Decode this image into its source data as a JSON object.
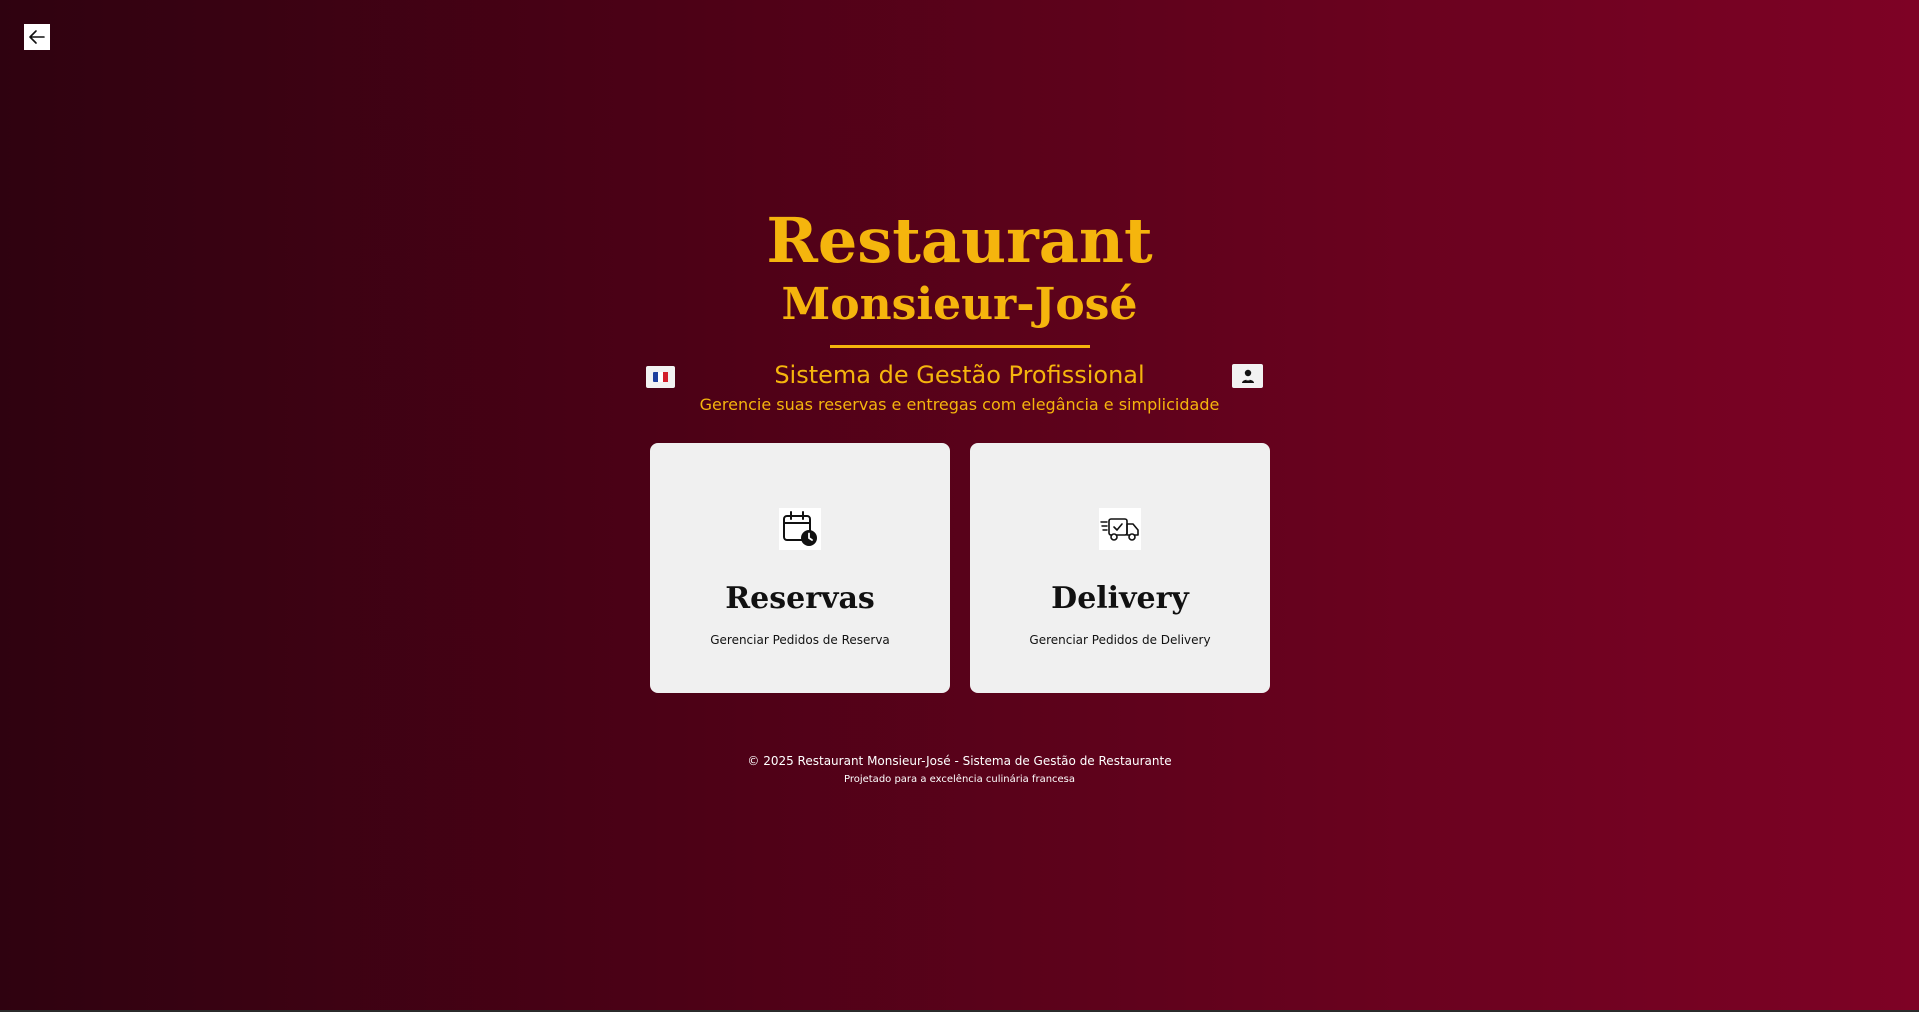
{
  "header": {
    "title_line1": "Restaurant",
    "title_line2": "Monsieur-José",
    "subtitle": "Sistema de Gestão Profissional",
    "tagline": "Gerencie suas reservas e entregas com elegância e simplicidade"
  },
  "colors": {
    "accent": "#f5b50d",
    "card_bg": "#f0f0f0",
    "bg_start": "#2f0210",
    "bg_end": "#7e0225"
  },
  "cards": [
    {
      "title": "Reservas",
      "description": "Gerenciar Pedidos de Reserva",
      "icon": "calendar-clock-icon"
    },
    {
      "title": "Delivery",
      "description": "Gerenciar Pedidos de Delivery",
      "icon": "delivery-truck-icon"
    }
  ],
  "controls": {
    "back_icon": "arrow-left-icon",
    "language_icon": "french-flag-icon",
    "admin_icon": "user-admin-icon"
  },
  "footer": {
    "copyright": "© 2025 Restaurant Monsieur-José - Sistema de Gestão de Restaurante",
    "note": "Projetado para a excelência culinária francesa"
  }
}
